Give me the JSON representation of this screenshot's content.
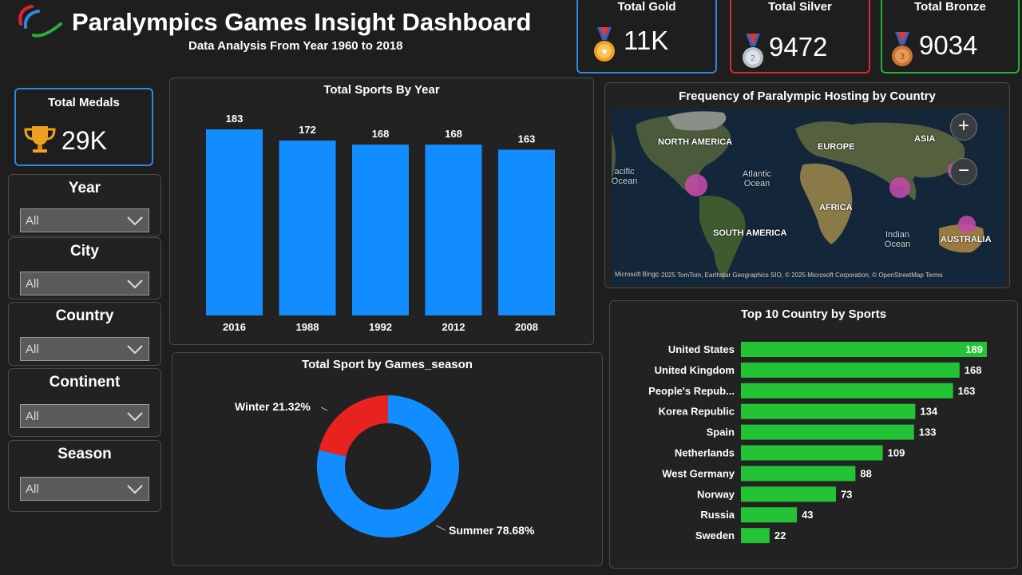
{
  "header": {
    "title": "Paralympics Games Insight Dashboard",
    "subtitle": "Data Analysis From Year 1960 to 2018"
  },
  "kpis": {
    "gold": {
      "label": "Total Gold",
      "value": "11K",
      "color": "#2e88e0"
    },
    "silver": {
      "label": "Total Silver",
      "value": "9472",
      "color": "#e0262a"
    },
    "bronze": {
      "label": "Total Bronze",
      "value": "9034",
      "color": "#27b03a"
    },
    "total": {
      "label": "Total Medals",
      "value": "29K",
      "color": "#2e88e0"
    }
  },
  "slicers": [
    {
      "label": "Year",
      "value": "All"
    },
    {
      "label": "City",
      "value": "All"
    },
    {
      "label": "Country",
      "value": "All"
    },
    {
      "label": "Continent",
      "value": "All"
    },
    {
      "label": "Season",
      "value": "All"
    }
  ],
  "map": {
    "title": "Frequency of Paralympic Hosting by Country",
    "labels": {
      "north_america": "NORTH AMERICA",
      "europe": "EUROPE",
      "asia": "ASIA",
      "africa": "AFRICA",
      "south_america": "SOUTH AMERICA",
      "australia": "AUSTRALIA",
      "atlantic": "Atlantic Ocean",
      "pacific": "acific Ocean",
      "indian": "Indian Ocean"
    },
    "zoom_in": "+",
    "zoom_out": "−",
    "attribution": "© 2025 TomTom, Earthstar Geographics SIO, © 2025 Microsoft Corporation, © OpenStreetMap  Terms",
    "logo": "Microsoft Bing",
    "bubble_color": "#c14aa8"
  },
  "chart_data": [
    {
      "type": "bar",
      "title": "Total Sports By Year",
      "categories": [
        "2016",
        "1988",
        "1992",
        "2012",
        "2008"
      ],
      "values": [
        183,
        172,
        168,
        168,
        163
      ],
      "color": "#118dff"
    },
    {
      "type": "pie",
      "title": "Total Sport by Games_season",
      "slices": [
        {
          "label": "Winter",
          "percent": 21.32,
          "display": "Winter 21.32%",
          "color": "#e8231f"
        },
        {
          "label": "Summer",
          "percent": 78.68,
          "display": "Summer 78.68%",
          "color": "#118dff"
        }
      ]
    },
    {
      "type": "bar",
      "orientation": "horizontal",
      "title": "Top 10 Country by Sports",
      "categories": [
        "United States",
        "United Kingdom",
        "People's Repub...",
        "Korea Republic",
        "Spain",
        "Netherlands",
        "West Germany",
        "Norway",
        "Russia",
        "Sweden"
      ],
      "values": [
        189,
        168,
        163,
        134,
        133,
        109,
        88,
        73,
        43,
        22
      ],
      "color": "#22c334"
    }
  ]
}
